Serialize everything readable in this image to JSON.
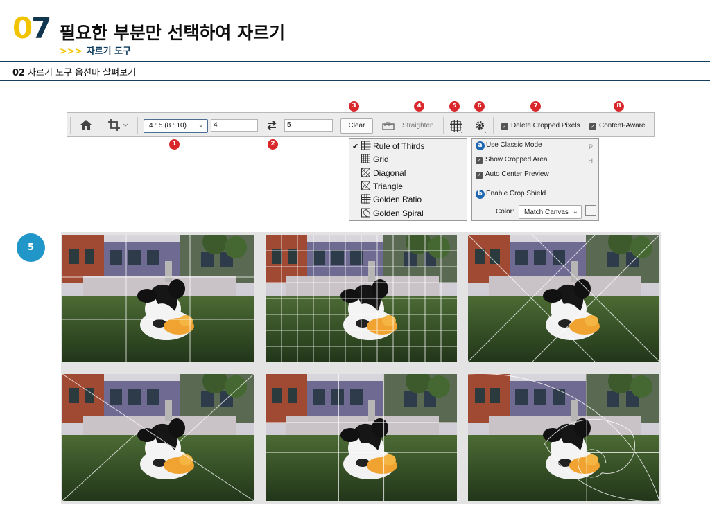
{
  "header": {
    "chapter_number": "07",
    "chapter_title": "필요한 부분만 선택하여 자르기",
    "subtitle_arrows": ">>>",
    "subtitle": "자르기 도구"
  },
  "section": {
    "number": "02",
    "title": "자르기 도구 옵션바 살펴보기"
  },
  "options_bar": {
    "home_icon": "home-icon",
    "crop_icon": "crop-tool-icon",
    "ratio_value": "4 : 5 (8 : 10)",
    "width_value": "4",
    "swap_icon": "swap-arrows-icon",
    "height_value": "5",
    "clear_label": "Clear",
    "straighten_label": "Straighten",
    "overlay_icon": "grid-overlay-icon",
    "settings_icon": "gear-icon",
    "delete_cropped_label": "Delete Cropped Pixels",
    "content_aware_label": "Content-Aware"
  },
  "markers": {
    "m1": "1",
    "m2": "2",
    "m3": "3",
    "m4": "4",
    "m5": "5",
    "m6": "6",
    "m7": "7",
    "m8": "8"
  },
  "overlay_menu": {
    "items": [
      {
        "label": "Rule of Thirds",
        "checked": true
      },
      {
        "label": "Grid",
        "checked": false
      },
      {
        "label": "Diagonal",
        "checked": false
      },
      {
        "label": "Triangle",
        "checked": false
      },
      {
        "label": "Golden Ratio",
        "checked": false
      },
      {
        "label": "Golden Spiral",
        "checked": false
      }
    ]
  },
  "settings_menu": {
    "badge_a": "a",
    "use_classic": "Use Classic Mode",
    "use_classic_key": "P",
    "show_cropped": "Show Cropped Area",
    "show_cropped_key": "H",
    "auto_center": "Auto Center Preview",
    "badge_b": "b",
    "enable_shield": "Enable Crop Shield",
    "color_label": "Color:",
    "color_value": "Match Canvas"
  },
  "step_badge": "5",
  "photos": [
    {
      "overlay": "rule-of-thirds"
    },
    {
      "overlay": "grid"
    },
    {
      "overlay": "diagonal"
    },
    {
      "overlay": "triangle"
    },
    {
      "overlay": "golden-ratio"
    },
    {
      "overlay": "golden-spiral"
    }
  ],
  "colors": {
    "marker_red": "#d8282b",
    "chapter_yellow": "#f2c400",
    "navy": "#10354f",
    "step_blue": "#2196c8",
    "badge_blue": "#1f67b0"
  }
}
